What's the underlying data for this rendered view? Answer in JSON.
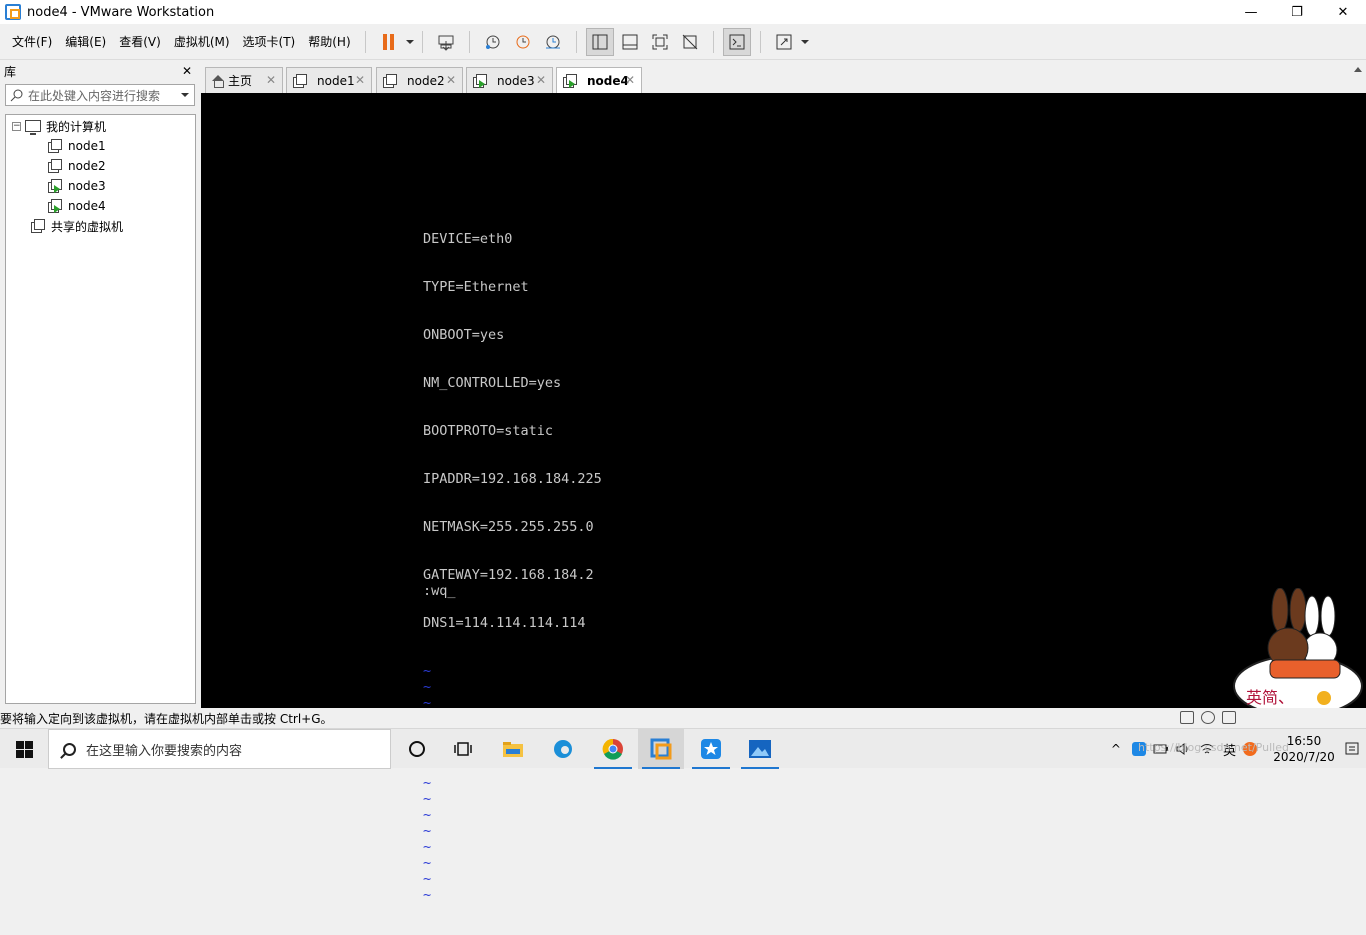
{
  "window": {
    "title": "node4 - VMware Workstation",
    "minimize": "—",
    "maximize": "❐",
    "close": "✕"
  },
  "menu": [
    "文件(F)",
    "编辑(E)",
    "查看(V)",
    "虚拟机(M)",
    "选项卡(T)",
    "帮助(H)"
  ],
  "library": {
    "title": "库",
    "close": "✕",
    "search_placeholder": "在此处键入内容进行搜索",
    "tree": {
      "root": "我的计算机",
      "vms": [
        {
          "name": "node1",
          "running": false
        },
        {
          "name": "node2",
          "running": false
        },
        {
          "name": "node3",
          "running": true
        },
        {
          "name": "node4",
          "running": true
        }
      ],
      "shared": "共享的虚拟机"
    }
  },
  "tabs": [
    {
      "label": "主页",
      "icon": "home-icon",
      "active": false
    },
    {
      "label": "node1",
      "icon": "vm-icon",
      "active": false
    },
    {
      "label": "node2",
      "icon": "vm-icon",
      "active": false
    },
    {
      "label": "node3",
      "icon": "vm-running-icon",
      "active": false
    },
    {
      "label": "node4",
      "icon": "vm-running-icon",
      "active": true
    }
  ],
  "tab_close": "✕",
  "console": {
    "lines": [
      "DEVICE=eth0",
      "TYPE=Ethernet",
      "ONBOOT=yes",
      "NM_CONTROLLED=yes",
      "BOOTPROTO=static",
      "IPADDR=192.168.184.225",
      "NETMASK=255.255.255.0",
      "GATEWAY=192.168.184.2",
      "DNS1=114.114.114.114"
    ],
    "tilde": "~",
    "tilde_count": 15,
    "command": ":wq_"
  },
  "sticker": {
    "text": "英简、"
  },
  "status": {
    "message": "要将输入定向到该虚拟机，请在虚拟机内部单击或按 Ctrl+G。"
  },
  "taskbar": {
    "search_placeholder": "在这里输入你要搜索的内容",
    "time": "16:50",
    "date": "2020/7/20",
    "ime": "英",
    "watermark": "https://blog.csdn.net/Pulled_"
  },
  "colors": {
    "console_bg": "#000000",
    "console_text": "#c8c8c8",
    "vim_tilde": "#2b3bd6",
    "pause_orange": "#e86b1a"
  }
}
